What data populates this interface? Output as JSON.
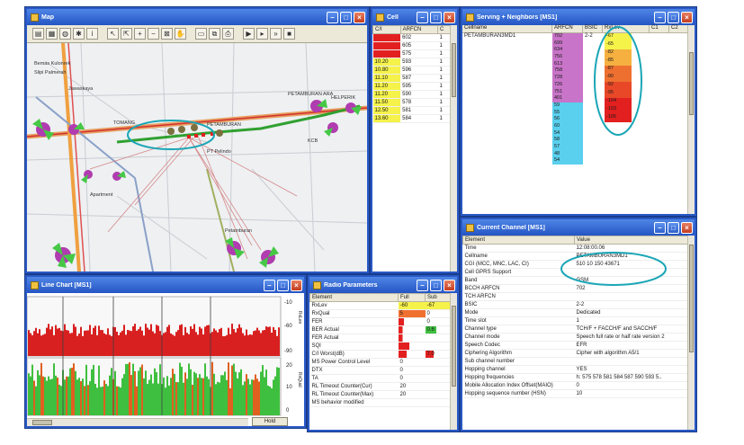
{
  "colors": {
    "title_bar": "#2455c4",
    "highlight_ellipse": "#1aa6b6",
    "fill_red": "#e32020",
    "fill_yellow": "#f5f24a",
    "fill_magenta": "#c874c8",
    "fill_cyan": "#5ad0ee",
    "fill_green": "#3fbf3f"
  },
  "map": {
    "title": "Map",
    "tools": [
      "layer-icon",
      "map-icon",
      "globe-icon",
      "gear-icon",
      "info-icon",
      "pointer-icon",
      "select-icon",
      "zoom-in-icon",
      "zoom-out-icon",
      "zoom-area-icon",
      "pan-icon",
      "ruler-icon",
      "copy-icon",
      "print-icon",
      "play-icon",
      "step-forward-icon",
      "fast-forward-icon",
      "stop-icon"
    ],
    "labels": [
      "Bemas Kulonrek",
      "Slipi Palmerah",
      "Jawaskaya",
      "PETAMBURAN",
      "TOMANG",
      "PT Pelindo",
      "Apartment",
      "Petamburan",
      "KCB",
      "PETAMBURAN ARA",
      "HELPERIK"
    ]
  },
  "cell_window": {
    "title": "Cell",
    "headers": [
      "C/I",
      "ARFCN",
      "C"
    ],
    "rows": [
      [
        "",
        "602",
        "1"
      ],
      [
        "",
        "605",
        "1"
      ],
      [
        "",
        "575",
        "1"
      ],
      [
        "10.20",
        "593",
        "1"
      ],
      [
        "10.80",
        "596",
        "1"
      ],
      [
        "11.10",
        "587",
        "1"
      ],
      [
        "11.20",
        "595",
        "1"
      ],
      [
        "11.20",
        "590",
        "1"
      ],
      [
        "11.50",
        "578",
        "1"
      ],
      [
        "12.50",
        "581",
        "1"
      ],
      [
        "13.60",
        "584",
        "1"
      ]
    ]
  },
  "serving_window": {
    "title": "Serving + Neighbors [MS1]",
    "headers": [
      "Cellname",
      "ARFCN",
      "BSIC",
      "RxLev",
      "C1",
      "C2"
    ],
    "cellname": "PETAMBURAN3MD1",
    "bsic": "2-2",
    "arfcn_values": [
      "702",
      "699",
      "634",
      "756",
      "613",
      "758",
      "728",
      "726",
      "751",
      "401",
      "59",
      "55",
      "56",
      "60",
      "54",
      "58",
      "57",
      "48",
      "54"
    ],
    "rxlev_values": [
      "-67",
      "-65",
      "-82",
      "-85",
      "-87",
      "-90",
      "-92",
      "-95",
      "-104",
      "-103",
      "-105"
    ]
  },
  "current_channel": {
    "title": "Current Channel [MS1]",
    "headers": [
      "Element",
      "Value"
    ],
    "rows": [
      [
        "Time",
        "12:08:00.06"
      ],
      [
        "Cellname",
        "PETAMBURAN3MD1"
      ],
      [
        "CGI (MCC, MNC, LAC, CI)",
        "510 10 150 43671"
      ],
      [
        "Cell GPRS Support",
        ""
      ],
      [
        "Band",
        "GSM"
      ],
      [
        "BCCH ARFCN",
        "702"
      ],
      [
        "TCH ARFCN",
        ""
      ],
      [
        "BSIC",
        "2-2"
      ],
      [
        "Mode",
        "Dedicated"
      ],
      [
        "Time slot",
        "1"
      ],
      [
        "Channel type",
        "TCH/F + FACCH/F and SACCH/F"
      ],
      [
        "Channel mode",
        "Speech full rate or half rate version 2"
      ],
      [
        "Speech Codec",
        "EFR"
      ],
      [
        "Ciphering Algorithm",
        "Cipher with algorithm A5/1"
      ],
      [
        "Sub channel number",
        ""
      ],
      [
        "Hopping channel",
        "YES"
      ],
      [
        "Hopping frequencies",
        "h: 575 578 581 584 587 590 593 5.."
      ],
      [
        "Mobile Allocation Index Offset(MAIO)",
        "0"
      ],
      [
        "Hopping sequence number (HSN)",
        "10"
      ]
    ]
  },
  "line_chart": {
    "title": "Line Chart [MS1]",
    "upper_ticks": [
      "-10",
      "-60",
      "-90"
    ],
    "lower_ticks": [
      "20",
      "10",
      "0"
    ],
    "upper_axis_label": "RxLev",
    "lower_axis_label": "RxQual",
    "hold_label": "Hold"
  },
  "radio_params": {
    "title": "Radio Parameters",
    "headers": [
      "Element",
      "Full",
      "Sub"
    ],
    "rows": [
      [
        "RxLev",
        "-60",
        "-67"
      ],
      [
        "RxQual",
        "5",
        "0"
      ],
      [
        "FER",
        "",
        "0"
      ],
      [
        "BER Actual",
        "",
        "0.6"
      ],
      [
        "FER Actual",
        "",
        ""
      ],
      [
        "SQI",
        "",
        ""
      ],
      [
        "C/I Worst(dB)",
        "",
        "7.0"
      ],
      [
        "MS Power Control Level",
        "0",
        ""
      ],
      [
        "DTX",
        "0",
        ""
      ],
      [
        "TA",
        "0",
        ""
      ],
      [
        "RL Timeout Counter(Cur)",
        "20",
        ""
      ],
      [
        "RL Timeout Counter(Max)",
        "20",
        ""
      ],
      [
        "MS behavior modified",
        "",
        ""
      ]
    ]
  }
}
